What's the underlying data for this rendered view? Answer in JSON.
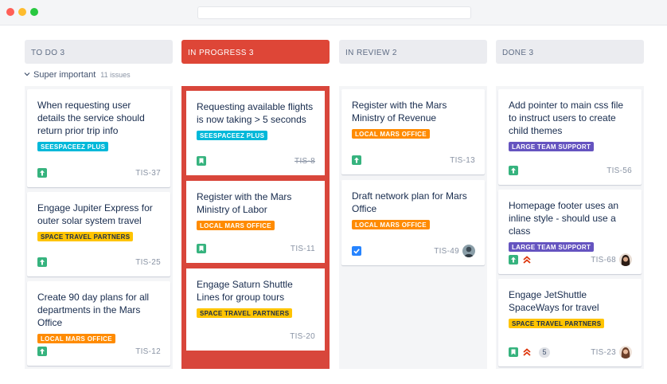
{
  "colors": {
    "active_column": "#de4637",
    "story": "#36b37e",
    "bug_blue": "#2684ff",
    "priority_high": "#de350b",
    "label_cyan": "#00b8d9",
    "label_orange": "#ff8b00",
    "label_yellow": "#ffc400",
    "label_purple": "#6554c0"
  },
  "swimlane": {
    "title": "Super important",
    "count": "11 issues"
  },
  "columns": [
    {
      "name": "TO DO",
      "count": "3",
      "cards": [
        {
          "title": "When requesting user details the service should return prior trip info",
          "label": "SEESPACEEZ PLUS",
          "label_color": "cyan",
          "type": "story-icon",
          "key": "TIS-37"
        },
        {
          "title": "Engage Jupiter Express for outer solar system travel",
          "label": "SPACE TRAVEL PARTNERS",
          "label_color": "yellow",
          "type": "story-icon",
          "key": "TIS-25"
        },
        {
          "title": "Create 90 day plans for all departments in the Mars Office",
          "label": "LOCAL MARS OFFICE",
          "label_color": "orange",
          "type": "story-icon",
          "key": "TIS-12"
        }
      ]
    },
    {
      "name": "IN PROGRESS",
      "count": "3",
      "cards": [
        {
          "title": "Requesting available flights is now taking > 5 seconds",
          "label": "SEESPACEEZ PLUS",
          "label_color": "cyan",
          "type": "bookmark-icon",
          "key": "TIS-8"
        },
        {
          "title": "Register with the Mars Ministry of Labor",
          "label": "LOCAL MARS OFFICE",
          "label_color": "orange",
          "type": "bookmark-icon",
          "key": "TIS-11"
        },
        {
          "title": "Engage Saturn Shuttle Lines for group tours",
          "label": "SPACE TRAVEL PARTNERS",
          "label_color": "yellow",
          "type": "",
          "key": "TIS-20"
        }
      ]
    },
    {
      "name": "IN REVIEW",
      "count": "2",
      "cards": [
        {
          "title": "Register with the Mars Ministry of Revenue",
          "label": "LOCAL MARS OFFICE",
          "label_color": "orange",
          "type": "story-icon",
          "key": "TIS-13"
        },
        {
          "title": "Draft network plan for Mars Office",
          "label": "LOCAL MARS OFFICE",
          "label_color": "orange",
          "type": "task-check-icon",
          "key": "TIS-49"
        }
      ]
    },
    {
      "name": "DONE",
      "count": "3",
      "cards": [
        {
          "title": "Add pointer to main css file to instruct users to create child themes",
          "label": "LARGE TEAM SUPPORT",
          "label_color": "purple",
          "type": "story-icon",
          "key": "TIS-56"
        },
        {
          "title": "Homepage footer uses an inline style - should use a class",
          "label": "LARGE TEAM SUPPORT",
          "label_color": "purple",
          "type": "story-icon",
          "priority": "priority-high-icon",
          "key": "TIS-68"
        },
        {
          "title": "Engage JetShuttle SpaceWays for travel",
          "label": "SPACE TRAVEL PARTNERS",
          "label_color": "yellow",
          "type": "bookmark-icon",
          "priority": "priority-high-icon",
          "estimate": "5",
          "key": "TIS-23"
        }
      ]
    }
  ]
}
